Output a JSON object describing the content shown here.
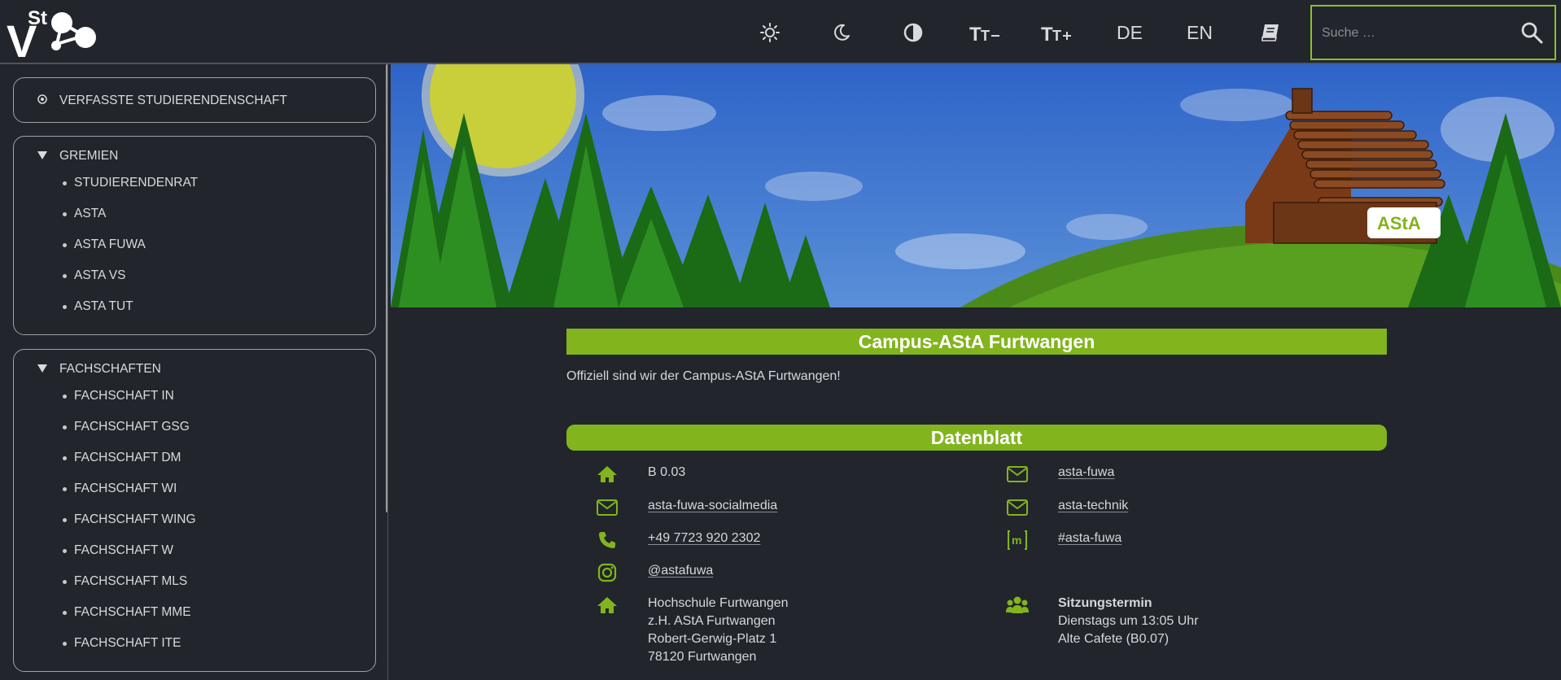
{
  "header": {
    "logo_text": "VSt",
    "icons": [
      "sun-icon",
      "moon-icon",
      "contrast-icon",
      "font-decrease-icon",
      "font-increase-icon",
      "book-icon"
    ],
    "lang_de": "DE",
    "lang_en": "EN",
    "search_placeholder": "Suche …"
  },
  "sidebar": {
    "section1": {
      "label": "VERFASSTE STUDIERENDENSCHAFT"
    },
    "gremien": {
      "label": "GREMIEN",
      "items": [
        "STUDIERENDENRAT",
        "ASTA",
        "ASTA FUWA",
        "ASTA VS",
        "ASTA TUT"
      ]
    },
    "fachschaften": {
      "label": "FACHSCHAFTEN",
      "items": [
        "FACHSCHAFT IN",
        "FACHSCHAFT GSG",
        "FACHSCHAFT DM",
        "FACHSCHAFT WI",
        "FACHSCHAFT WING",
        "FACHSCHAFT W",
        "FACHSCHAFT MLS",
        "FACHSCHAFT MME",
        "FACHSCHAFT ITE"
      ]
    }
  },
  "banner": {
    "sign_text": "AStA"
  },
  "main": {
    "title": "Campus-AStA Furtwangen",
    "intro": "Offiziell sind wir der Campus-AStA Furtwangen!",
    "datenblatt_title": "Datenblatt",
    "left": {
      "room": "B 0.03",
      "mail_social": "asta-fuwa-socialmedia",
      "phone": "+49 7723 920 2302",
      "instagram": "@astafuwa",
      "address": [
        "Hochschule Furtwangen",
        "z.H. AStA Furtwangen",
        "Robert-Gerwig-Platz 1",
        "78120 Furtwangen"
      ]
    },
    "right": {
      "mail1": "asta-fuwa",
      "mail2": "asta-technik",
      "matrix": "#asta-fuwa",
      "matrix_icon_letter": "m",
      "meeting_title": "Sitzungstermin",
      "meeting_time": "Dienstags um 13:05 Uhr",
      "meeting_place": "Alte Cafete (B0.07)"
    }
  },
  "colors": {
    "accent": "#82b41d",
    "background": "#22252c",
    "border": "#9ea1a6"
  }
}
